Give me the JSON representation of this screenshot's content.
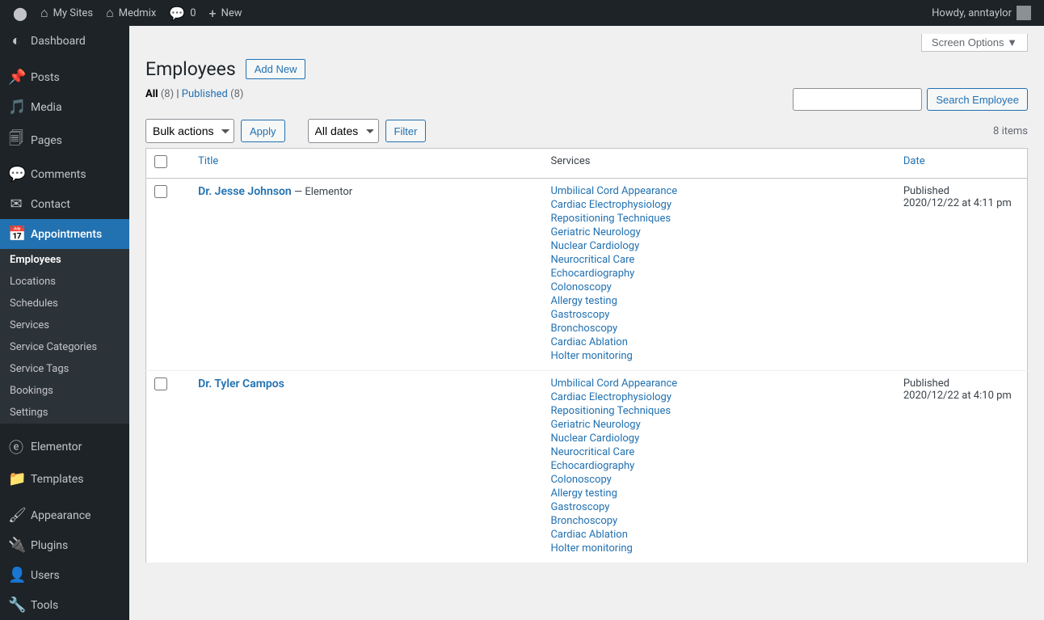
{
  "adminbar": {
    "mysites": "My Sites",
    "sitename": "Medmix",
    "comments": "0",
    "new": "New",
    "howdy": "Howdy, anntaylor"
  },
  "sidebar": {
    "dashboard": "Dashboard",
    "posts": "Posts",
    "media": "Media",
    "pages": "Pages",
    "comments": "Comments",
    "contact": "Contact",
    "appointments": "Appointments",
    "submenu": {
      "employees": "Employees",
      "locations": "Locations",
      "schedules": "Schedules",
      "services": "Services",
      "service_categories": "Service Categories",
      "service_tags": "Service Tags",
      "bookings": "Bookings",
      "settings": "Settings"
    },
    "elementor": "Elementor",
    "templates": "Templates",
    "appearance": "Appearance",
    "plugins": "Plugins",
    "users": "Users",
    "tools": "Tools"
  },
  "screen_options": "Screen Options ▼",
  "heading": "Employees",
  "add_new": "Add New",
  "subsubsub": {
    "all": "All",
    "all_count": "(8)",
    "sep": " | ",
    "published": "Published",
    "published_count": "(8)"
  },
  "search_btn": "Search Employee",
  "bulk_actions": "Bulk actions",
  "apply": "Apply",
  "all_dates": "All dates",
  "filter": "Filter",
  "items_count": "8 items",
  "table": {
    "headers": {
      "title": "Title",
      "services": "Services",
      "date": "Date"
    },
    "rows": [
      {
        "title": "Dr. Jesse Johnson",
        "suffix": " — Elementor",
        "services": [
          "Umbilical Cord Appearance",
          "Cardiac Electrophysiology",
          "Repositioning Techniques",
          "Geriatric Neurology",
          "Nuclear Cardiology",
          "Neurocritical Care",
          "Echocardiography",
          "Colonoscopy",
          "Allergy testing",
          "Gastroscopy",
          "Bronchoscopy",
          "Cardiac Ablation",
          "Holter monitoring"
        ],
        "status": "Published",
        "date": "2020/12/22 at 4:11 pm"
      },
      {
        "title": "Dr. Tyler Campos",
        "suffix": "",
        "services": [
          "Umbilical Cord Appearance",
          "Cardiac Electrophysiology",
          "Repositioning Techniques",
          "Geriatric Neurology",
          "Nuclear Cardiology",
          "Neurocritical Care",
          "Echocardiography",
          "Colonoscopy",
          "Allergy testing",
          "Gastroscopy",
          "Bronchoscopy",
          "Cardiac Ablation",
          "Holter monitoring"
        ],
        "status": "Published",
        "date": "2020/12/22 at 4:10 pm"
      }
    ]
  }
}
